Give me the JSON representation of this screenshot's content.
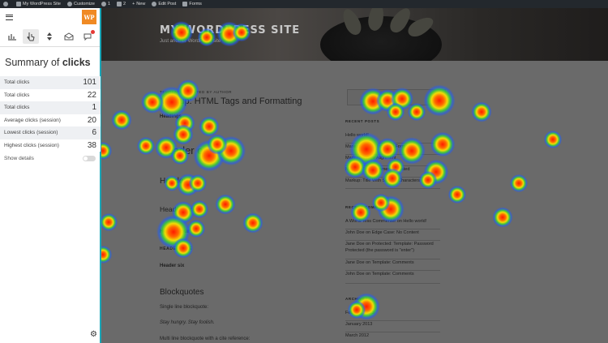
{
  "admin_bar": {
    "site_name": "My WordPress Site",
    "customize": "Customize",
    "updates": "1",
    "comments": "2",
    "new": "New",
    "edit_post": "Edit Post",
    "forms": "Forms"
  },
  "panel": {
    "logo_text": "WP",
    "summary_prefix": "Summary of ",
    "summary_bold": "clicks",
    "rows": [
      {
        "label": "Total clicks",
        "value": "101"
      },
      {
        "label": "Total clicks",
        "value": "22"
      },
      {
        "label": "Total clicks",
        "value": "1"
      },
      {
        "label": "Average clicks (session)",
        "value": "20"
      },
      {
        "label": "Lowest clicks (session)",
        "value": "6"
      },
      {
        "label": "Highest clicks (session)",
        "value": "38"
      }
    ],
    "show_details": "Show details",
    "toggle_state": "off",
    "icons": {
      "menu": "hamburger-menu-icon",
      "tabs": [
        "bar-chart-icon",
        "pointer-click-icon",
        "scroll-arrows-icon",
        "envelope-icon",
        "comment-icon"
      ],
      "settings": "gear-icon"
    },
    "accent_color": "#1aa6b7"
  },
  "site": {
    "title": "MY WORDPRESS SITE",
    "tagline": "Just another WordPress site"
  },
  "post": {
    "kicker": "TEMPLATE / POSTED BY AUTHOR",
    "title": "Markup: HTML Tags and Formatting",
    "headings_label": "Headings",
    "h1": "Header one",
    "h2": "Header two",
    "h3": "Header three",
    "h4": "Header four",
    "h5": "HEADER FIVE",
    "h6": "Header six",
    "blockquotes": "Blockquotes",
    "p1": "Single line blockquote:",
    "p2": "Stay hungry. Stay foolish.",
    "p3": "Multi line blockquote with a cite reference:"
  },
  "sidebar": {
    "recent_posts_title": "RECENT POSTS",
    "recent_posts": [
      "Hello world!",
      "Markup: HTML Tags and Formatting",
      "Markup: Image Alignment",
      "Markup: Text Alignment Updated",
      "Markup: Title With Special Characters"
    ],
    "recent_comments_title": "RECENT COMMENTS",
    "recent_comments": [
      "A WordPress Commenter on Hello world!",
      "John Doe on Edge Case: No Content",
      "Jane Doe on Protected: Template: Password Protected (the password is \"enter\")",
      "Jane Doe on Template: Comments",
      "John Doe on Template: Comments"
    ],
    "archives_title": "ARCHIVES",
    "archives": [
      "February 2013",
      "January 2013",
      "March 2012"
    ]
  },
  "heatmap_points": [
    [
      224,
      40,
      1.0
    ],
    [
      255,
      46,
      0.8
    ],
    [
      283,
      42,
      1.1
    ],
    [
      298,
      40,
      0.8
    ],
    [
      212,
      126,
      1.4
    ],
    [
      232,
      112,
      1.0
    ],
    [
      188,
      126,
      1.0
    ],
    [
      150,
      148,
      0.9
    ],
    [
      228,
      152,
      0.9
    ],
    [
      258,
      156,
      0.9
    ],
    [
      205,
      182,
      1.0
    ],
    [
      226,
      166,
      0.9
    ],
    [
      222,
      192,
      0.8
    ],
    [
      258,
      192,
      1.4
    ],
    [
      285,
      186,
      1.3
    ],
    [
      268,
      178,
      0.9
    ],
    [
      180,
      180,
      0.8
    ],
    [
      127,
      186,
      0.8
    ],
    [
      232,
      228,
      1.0
    ],
    [
      244,
      226,
      0.8
    ],
    [
      212,
      226,
      0.7
    ],
    [
      278,
      252,
      0.9
    ],
    [
      312,
      275,
      0.9
    ],
    [
      226,
      262,
      1.0
    ],
    [
      246,
      258,
      0.8
    ],
    [
      242,
      282,
      0.8
    ],
    [
      214,
      286,
      1.5
    ],
    [
      226,
      306,
      0.9
    ],
    [
      127,
      314,
      0.8
    ],
    [
      134,
      274,
      0.8
    ],
    [
      460,
      125,
      1.2
    ],
    [
      478,
      124,
      1.0
    ],
    [
      496,
      122,
      1.0
    ],
    [
      488,
      138,
      0.8
    ],
    [
      514,
      138,
      0.8
    ],
    [
      542,
      124,
      1.4
    ],
    [
      594,
      138,
      0.9
    ],
    [
      452,
      184,
      1.5
    ],
    [
      478,
      184,
      1.0
    ],
    [
      508,
      186,
      1.2
    ],
    [
      438,
      206,
      1.0
    ],
    [
      460,
      210,
      1.0
    ],
    [
      488,
      206,
      0.8
    ],
    [
      546,
      178,
      1.1
    ],
    [
      538,
      212,
      1.1
    ],
    [
      484,
      220,
      0.9
    ],
    [
      528,
      222,
      0.8
    ],
    [
      564,
      240,
      0.8
    ],
    [
      640,
      226,
      0.8
    ],
    [
      682,
      172,
      0.8
    ],
    [
      620,
      268,
      0.9
    ],
    [
      445,
      262,
      0.9
    ],
    [
      482,
      258,
      1.2
    ],
    [
      470,
      250,
      0.8
    ],
    [
      452,
      378,
      1.2
    ],
    [
      440,
      382,
      0.8
    ]
  ]
}
